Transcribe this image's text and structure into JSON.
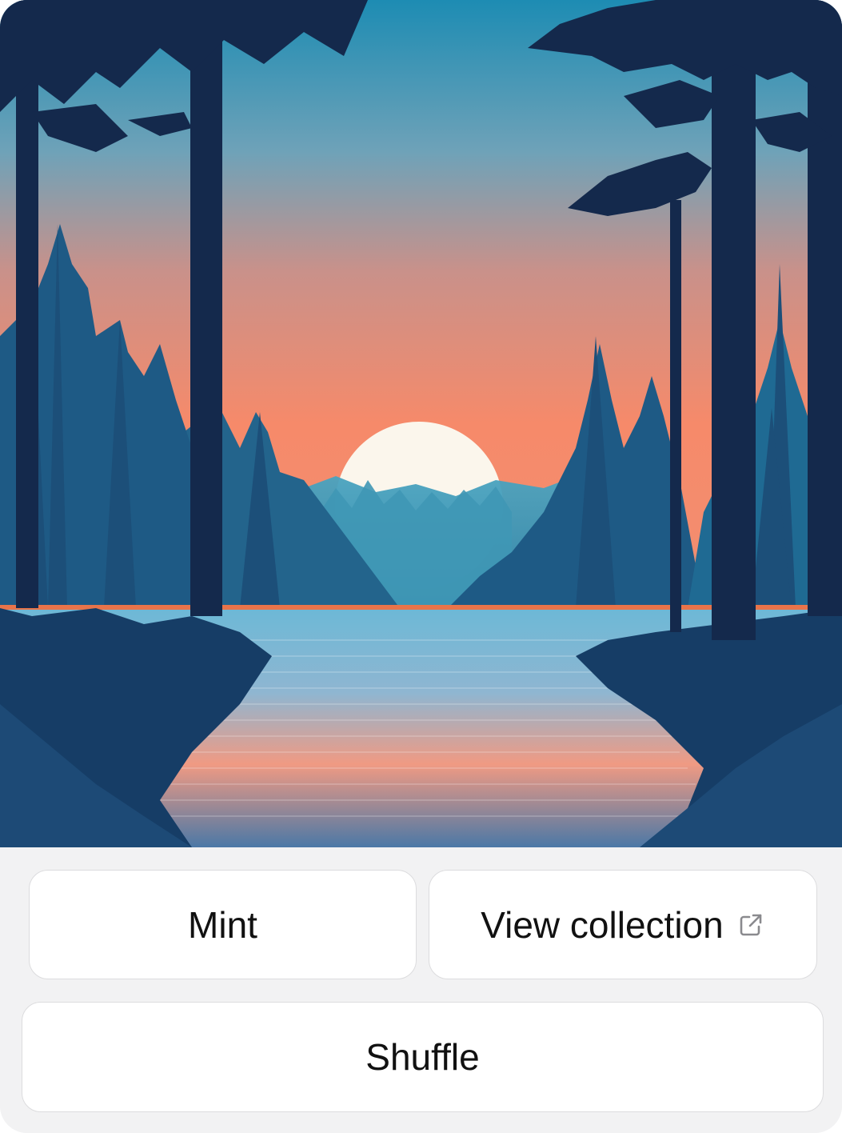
{
  "artwork": {
    "icon": "sunset-lake-forest-illustration",
    "colors": {
      "sky_top": "#1f8bb0",
      "sky_mid": "#f48a6a",
      "sun": "#fbf6ec",
      "tree_dark": "#14294c",
      "water": "#6fa6c8"
    }
  },
  "actions": {
    "mint_label": "Mint",
    "view_collection_label": "View collection",
    "view_collection_icon": "external-link-icon",
    "shuffle_label": "Shuffle"
  }
}
